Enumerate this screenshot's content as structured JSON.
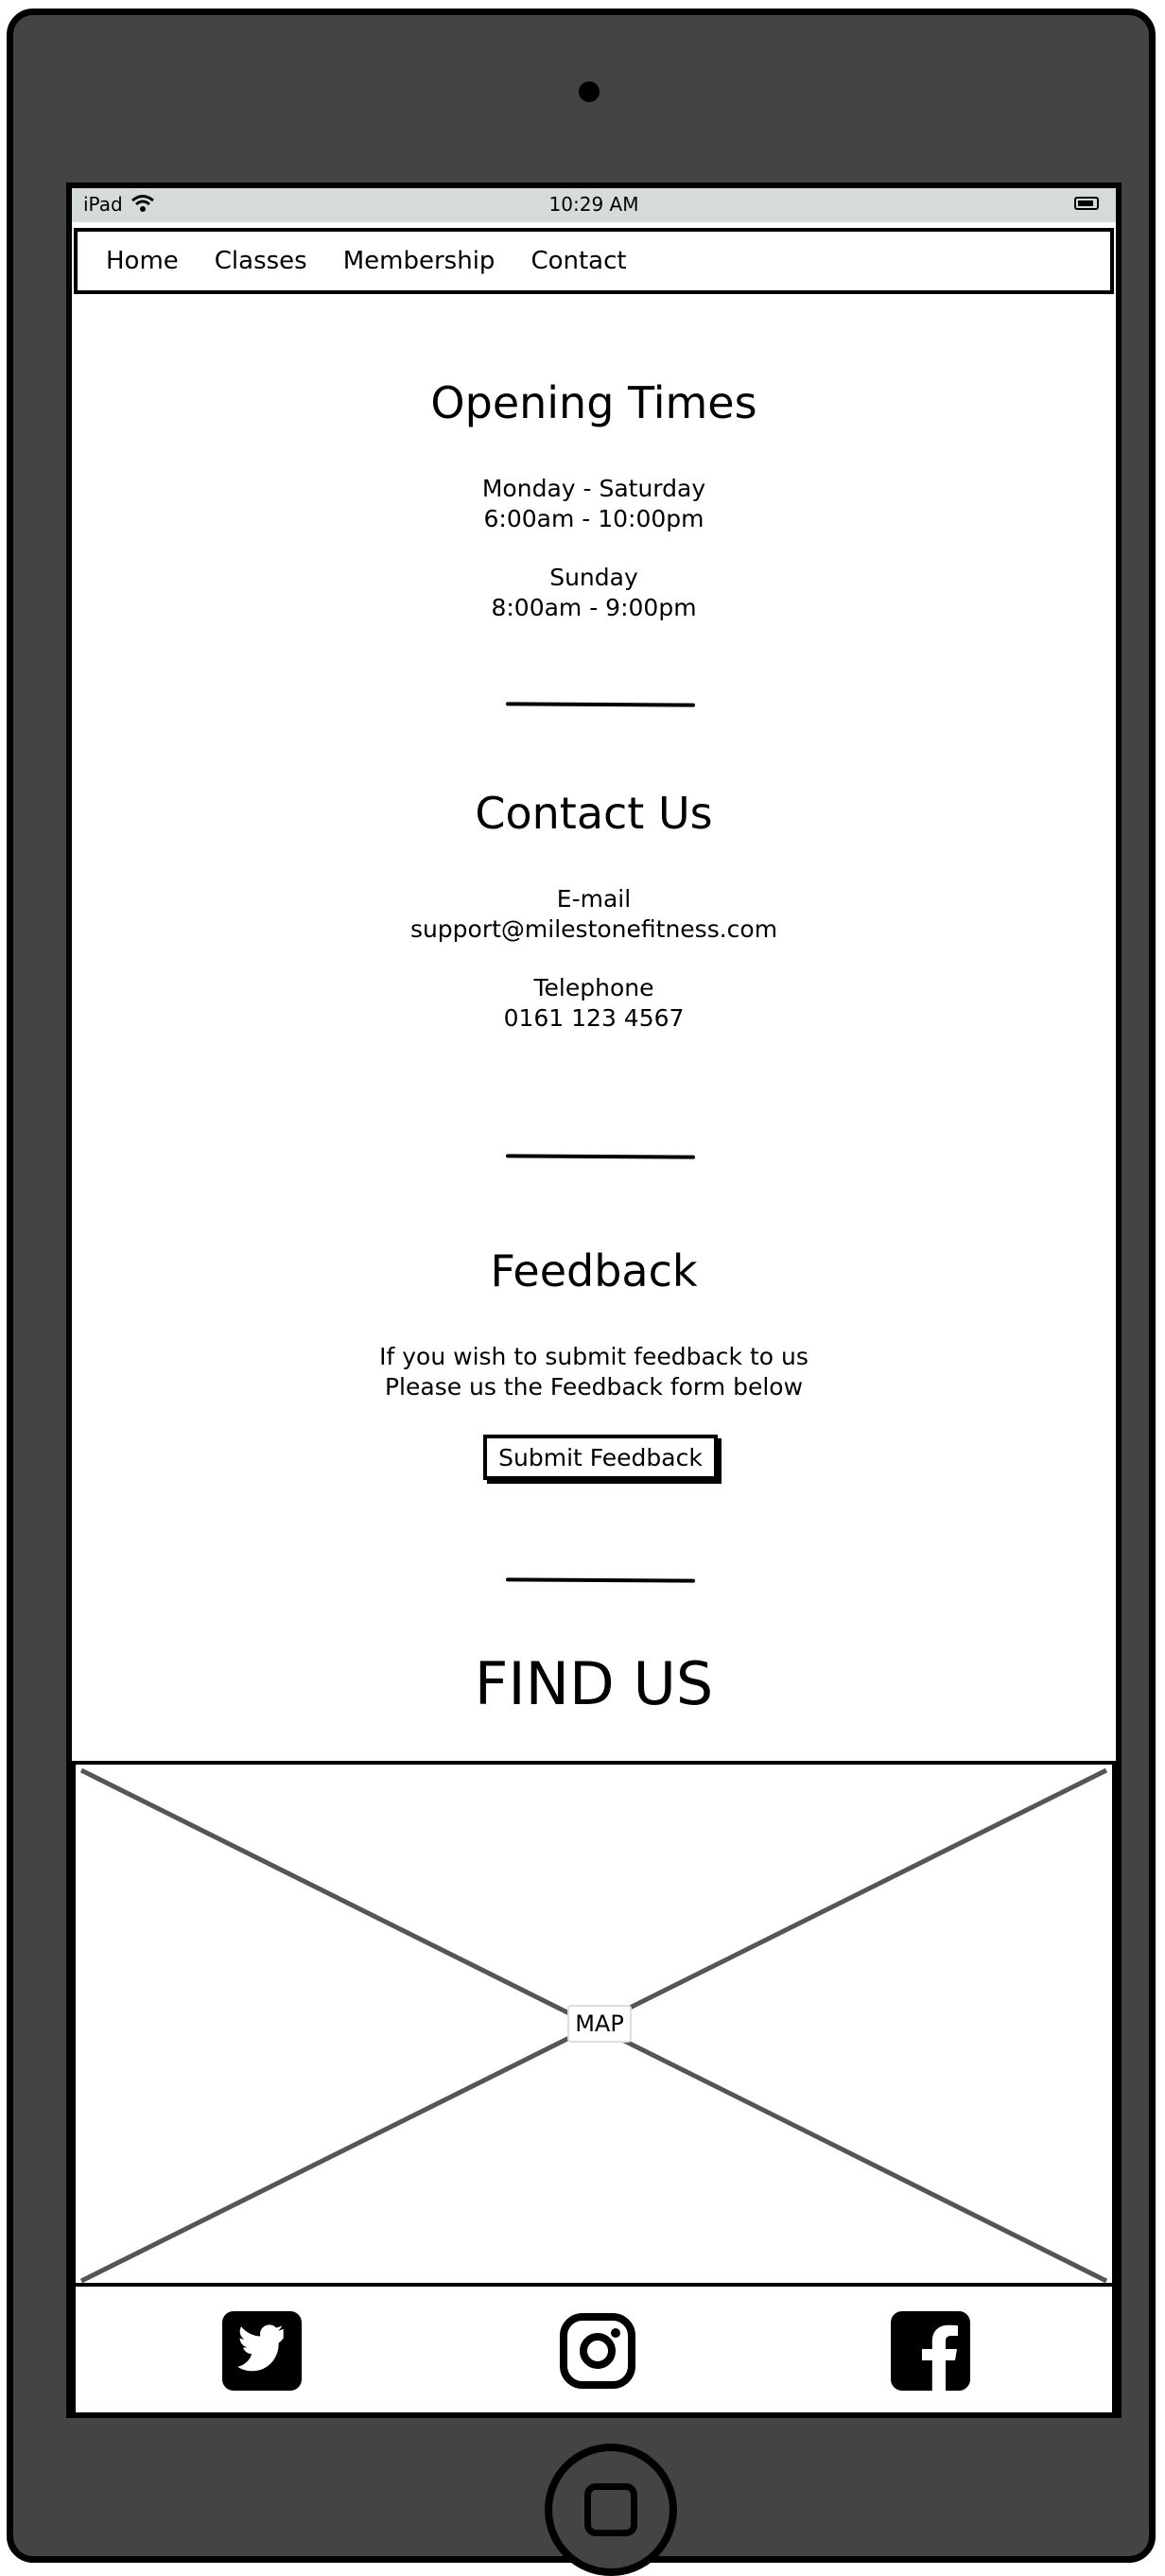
{
  "status_bar": {
    "carrier": "iPad",
    "time": "10:29 AM"
  },
  "nav": {
    "items": [
      "Home",
      "Classes",
      "Membership",
      "Contact"
    ]
  },
  "opening_times": {
    "title": "Opening Times",
    "weekday_label": "Monday - Saturday",
    "weekday_hours": "6:00am - 10:00pm",
    "sunday_label": "Sunday",
    "sunday_hours": "8:00am - 9:00pm"
  },
  "contact": {
    "title": "Contact Us",
    "email_label": "E-mail",
    "email": "support@milestonefitness.com",
    "phone_label": "Telephone",
    "phone": "0161 123 4567"
  },
  "feedback": {
    "title": "Feedback",
    "line1": "If you wish to submit feedback to us",
    "line2": "Please us the Feedback form below",
    "button_label": "Submit Feedback"
  },
  "find_us": {
    "title": "FIND US",
    "map_label": "MAP"
  },
  "footer": {
    "icons": [
      "twitter-icon",
      "instagram-icon",
      "facebook-icon"
    ]
  }
}
